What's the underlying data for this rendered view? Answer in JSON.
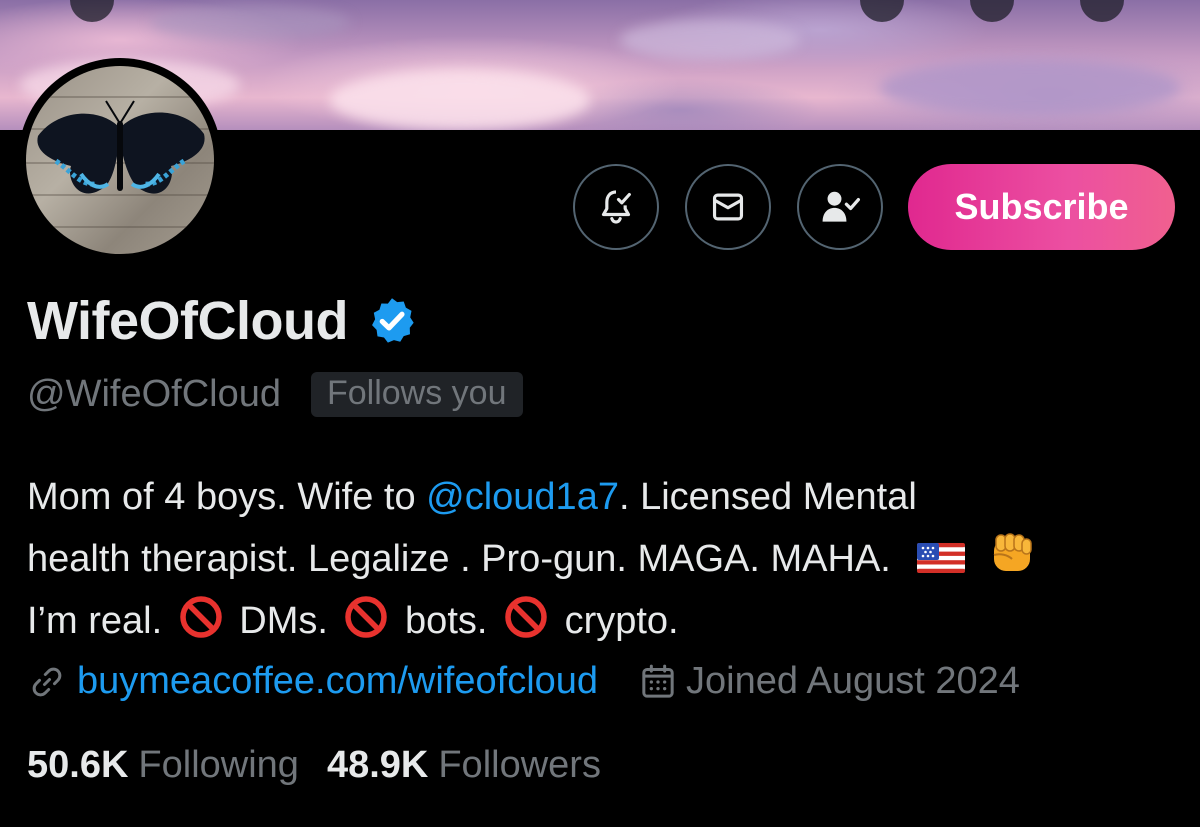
{
  "profile": {
    "display_name": "WifeOfCloud",
    "handle": "@WifeOfCloud",
    "follows_you_label": "Follows you",
    "verified": true,
    "bio": {
      "line1_pre": "Mom of 4 boys. Wife to ",
      "mention": "@cloud1a7",
      "line1_post": ". Licensed Mental",
      "line2": "health therapist. Legalize . Pro-gun. MAGA. MAHA.",
      "line3_a": "I’m real.",
      "line3_b": "DMs.",
      "line3_c": "bots.",
      "line3_d": "crypto."
    },
    "link": "buymeacoffee.com/wifeofcloud",
    "joined": "Joined August 2024",
    "following_count": "50.6K",
    "following_label": "Following",
    "followers_count": "48.9K",
    "followers_label": "Followers"
  },
  "actions": {
    "subscribe_label": "Subscribe",
    "notifications_icon": "bell-check-icon",
    "message_icon": "envelope-icon",
    "follow_icon": "person-check-icon"
  },
  "colors": {
    "background": "#000000",
    "accent_blue": "#1d9bf0",
    "muted_text": "#71767b",
    "subscribe_gradient_start": "#e0288f",
    "subscribe_gradient_end": "#f0608f"
  }
}
